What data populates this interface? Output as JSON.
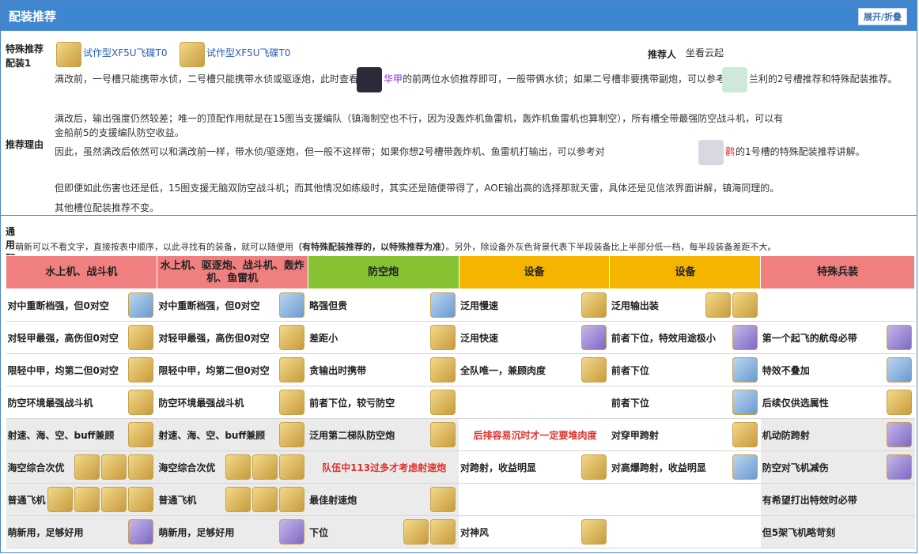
{
  "header": {
    "title": "配装推荐",
    "toggle": "展开/折叠"
  },
  "special": {
    "label_line1": "特殊推荐",
    "label_line2": "配装1",
    "item1": "试作型XF5U飞碟T0",
    "item2": "试作型XF5U飞碟T0",
    "recommender_label": "推荐人",
    "recommender": "坐看云起",
    "line1_a": "满改前，一号槽只能携带水侦，二号槽只能携带水侦或驱逐炮，此时查看",
    "line1_ship": "华甲",
    "line1_b": "的前两位水侦推荐即可，一般带俩水侦；如果二号槽非要携带副炮，可以参考",
    "line1_c": "兰利的2号槽推荐和特殊配装推荐。",
    "reason_label": "推荐理由",
    "r1": "满改后，输出强度仍然较差；唯一的顶配作用就是在15图当支援编队（镇海制空也不行，因为没轰炸机鱼雷机，轰炸机鱼雷机也算制空），所有槽全带最强防空战斗机，可以有",
    "r2": "金船前5的支援编队防空收益。",
    "r3_a": "因此，虽然满改后依然可以和满改前一样，带水侦/驱逐炮，但一般不这样带；如果你想2号槽带轰炸机、鱼雷机打输出，可以参考对",
    "r3_ship": "鹳",
    "r3_b": "的1号槽的特殊配装推荐讲解。",
    "r4": "但即便如此伤害也还是低，15图支援无脑双防空战斗机；而其他情况如练级时，其实还是随便带得了，AOE输出高的选择那就天雷，具体还是见信浓界面讲解，镇海同理的。",
    "r5": "其他槽位配装推荐不变。"
  },
  "general": {
    "title": "通用配装",
    "desc_a": "萌新可以不看文字，直接按表中顺序，以此寻找有的装备，就可以随便用",
    "desc_b": "（有特殊配装推荐的，以特殊推荐为准）",
    "desc_c": "。另外，除设备外灰色背景代表下半段装备比上半部分低一档，每半段装备差距不大。"
  },
  "table": {
    "headers": [
      "水上机、战斗机",
      "水上机、驱逐炮、战斗机、轰炸机、鱼雷机",
      "防空炮",
      "设备",
      "设备",
      "特殊兵装"
    ],
    "header_colors": [
      "#f08080",
      "#f08080",
      "#86c232",
      "#f5b400",
      "#f5b400",
      "#f08080"
    ],
    "rows": [
      [
        "对中重断档强，但0对空",
        "对中重断档强，但0对空",
        "略强但贵",
        "泛用慢速",
        "泛用输出装",
        ""
      ],
      [
        "对轻甲最强，高伤但0对空",
        "对轻甲最强，高伤但0对空",
        "差距小",
        "泛用快速",
        "前者下位，特效用途极小",
        "第一个起飞的航母必带"
      ],
      [
        "限轻中甲，均第二但0对空",
        "限轻中甲，均第二但0对空",
        "贪输出时携带",
        "全队唯一，兼顾肉度",
        "前者下位",
        "特效不叠加"
      ],
      [
        "防空环境最强战斗机",
        "防空环境最强战斗机",
        "前者下位，较亏防空",
        "",
        "前者下位",
        "后续仅供选属性"
      ],
      [
        "射速、海、空、buff兼顾",
        "射速、海、空、buff兼顾",
        "泛用第二梯队防空炮",
        "后排容易沉时才一定要堆肉度",
        "对穿甲跨射",
        "机动防跨射"
      ],
      [
        "海空综合次优",
        "海空综合次优",
        "队伍中113过多才考虑射速炮",
        "对跨射，收益明显",
        "对高爆跨射，收益明显",
        "防空对飞机减伤"
      ],
      [
        "普通飞机",
        "普通飞机",
        "最佳射速炮",
        "",
        "",
        "有希望打出特效时必带"
      ],
      [
        "萌新用，足够好用",
        "萌新用，足够好用",
        "下位",
        "对神风",
        "",
        "但5架飞机略苛刻"
      ]
    ]
  }
}
